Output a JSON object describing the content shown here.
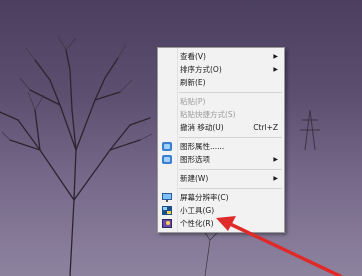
{
  "context_menu": {
    "view": "查看(V)",
    "sort": "排序方式(O)",
    "refresh": "刷新(E)",
    "paste": "粘贴(P)",
    "paste_shortcut": "粘贴快捷方式(S)",
    "undo_move": "撤消 移动(U)",
    "undo_shortcut": "Ctrl+Z",
    "graphics_properties": "图形属性......",
    "graphics_options": "图形选项",
    "new": "新建(W)",
    "screen_resolution": "屏幕分辨率(C)",
    "gadgets": "小工具(G)",
    "personalize": "个性化(R)"
  },
  "icons": {
    "graphics_properties": "intel-graphics-icon",
    "graphics_options": "intel-graphics-icon",
    "screen_resolution": "monitor-icon",
    "gadgets": "gadgets-icon",
    "personalize": "personalize-icon"
  },
  "colors": {
    "menu_bg": "#f2f2f2",
    "arrow_red": "#e02a2a",
    "desktop_purple": "#5c4f6f"
  }
}
